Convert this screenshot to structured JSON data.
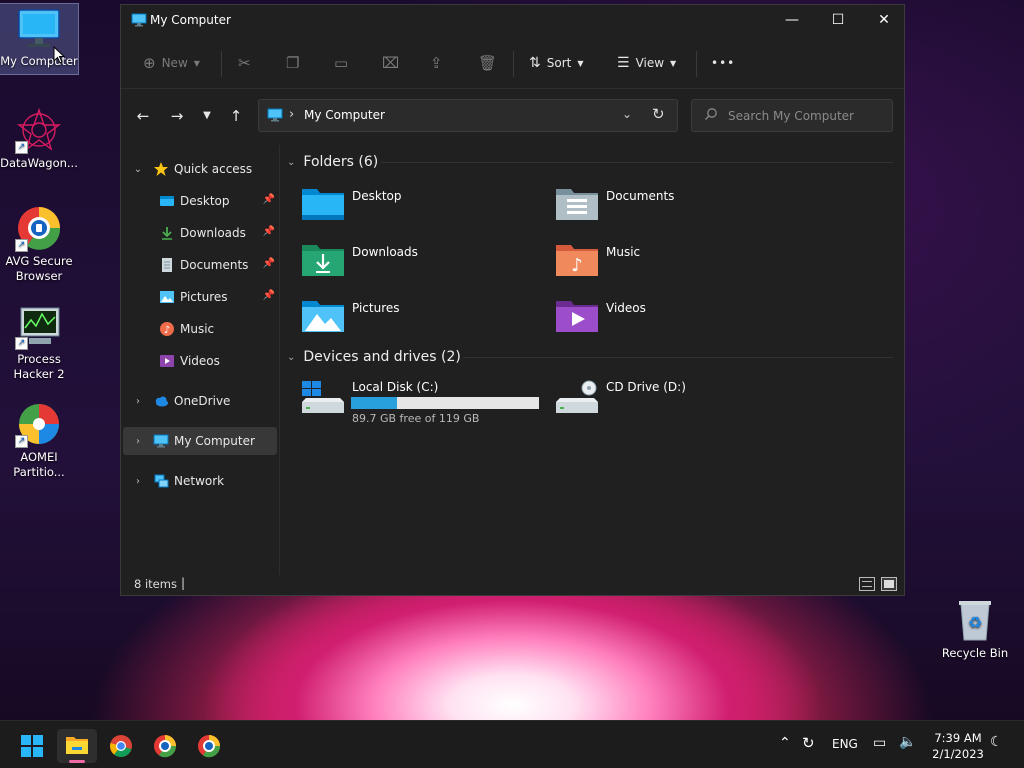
{
  "desktop": {
    "icons": [
      {
        "label": "My Computer"
      },
      {
        "label": "DataWagon..."
      },
      {
        "label": "AVG Secure Browser"
      },
      {
        "label": "Process Hacker 2"
      },
      {
        "label": "AOMEI Partitio..."
      },
      {
        "label": "Recycle Bin"
      }
    ]
  },
  "window": {
    "title": "My Computer",
    "controls": {
      "minimize": "—",
      "maximize": "☐",
      "close": "✕"
    }
  },
  "toolbar": {
    "new_label": "New",
    "sort_label": "Sort",
    "view_label": "View",
    "more_label": "•••"
  },
  "address": {
    "path": "My Computer",
    "search_placeholder": "Search My Computer"
  },
  "nav": {
    "quick_access": "Quick access",
    "items": [
      {
        "label": "Desktop"
      },
      {
        "label": "Downloads"
      },
      {
        "label": "Documents"
      },
      {
        "label": "Pictures"
      },
      {
        "label": "Music"
      },
      {
        "label": "Videos"
      }
    ],
    "onedrive": "OneDrive",
    "my_computer": "My Computer",
    "network": "Network"
  },
  "content": {
    "folders_header": "Folders (6)",
    "folders": [
      {
        "label": "Desktop"
      },
      {
        "label": "Documents"
      },
      {
        "label": "Downloads"
      },
      {
        "label": "Music"
      },
      {
        "label": "Pictures"
      },
      {
        "label": "Videos"
      }
    ],
    "drives_header": "Devices and drives (2)",
    "drives": [
      {
        "label": "Local Disk (C:)",
        "free": "89.7 GB free of 119 GB",
        "used_fraction": 0.246
      },
      {
        "label": "CD Drive (D:)"
      }
    ]
  },
  "status": {
    "count": "8 items",
    "caret": "|"
  },
  "taskbar": {
    "lang": "ENG",
    "time": "7:39 AM",
    "date": "2/1/2023"
  },
  "colors": {
    "window_bg": "#202020",
    "accent_blue": "#28a0dc",
    "indicator_pink": "#f06ba6"
  }
}
